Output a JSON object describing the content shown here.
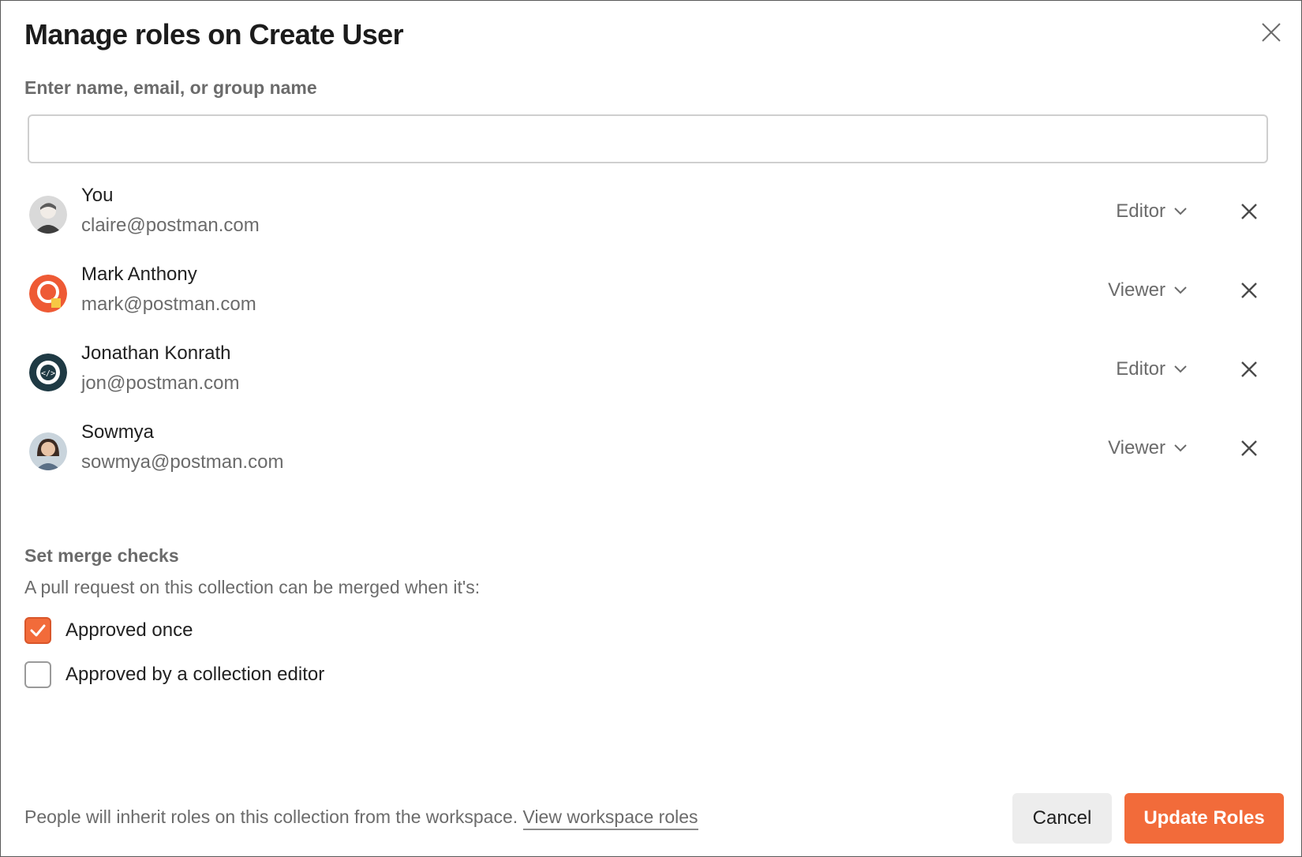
{
  "dialog": {
    "title": "Manage roles on Create User",
    "search": {
      "label": "Enter name, email, or group name",
      "value": "",
      "placeholder": ""
    },
    "members": [
      {
        "name": "You",
        "email": "claire@postman.com",
        "role": "Editor",
        "avatar": "photo-avatar-icon"
      },
      {
        "name": "Mark Anthony",
        "email": "mark@postman.com",
        "role": "Viewer",
        "avatar": "postman-orange-avatar-icon"
      },
      {
        "name": "Jonathan Konrath",
        "email": "jon@postman.com",
        "role": "Editor",
        "avatar": "postman-robot-avatar-icon"
      },
      {
        "name": "Sowmya",
        "email": "sowmya@postman.com",
        "role": "Viewer",
        "avatar": "photo-avatar-icon"
      }
    ],
    "merge_checks": {
      "title": "Set merge checks",
      "description": "A pull request on this collection can be merged when it's:",
      "options": [
        {
          "label": "Approved once",
          "checked": true
        },
        {
          "label": "Approved by a collection editor",
          "checked": false
        }
      ]
    },
    "footer": {
      "note": "People will inherit roles on this collection from the workspace.",
      "link": "View workspace roles",
      "cancel_label": "Cancel",
      "primary_label": "Update Roles"
    }
  },
  "colors": {
    "accent": "#f26b3a",
    "text": "#212121",
    "muted": "#6b6b6b",
    "border": "#cfcfcf"
  }
}
